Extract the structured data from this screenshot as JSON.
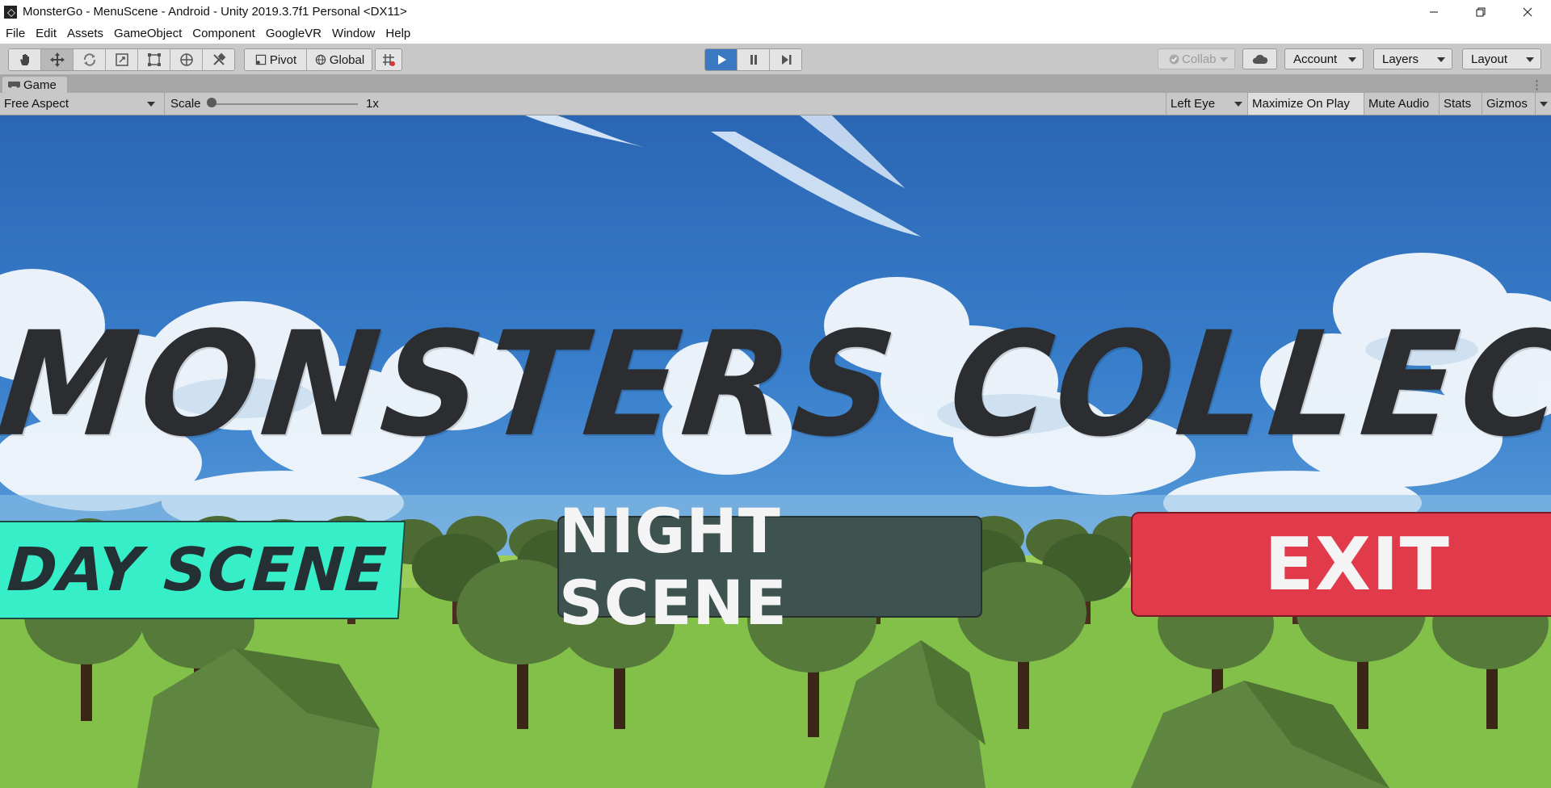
{
  "window": {
    "title": "MonsterGo - MenuScene - Android - Unity 2019.3.7f1 Personal <DX11>",
    "icon": "unity-logo-icon"
  },
  "menu": [
    "File",
    "Edit",
    "Assets",
    "GameObject",
    "Component",
    "GoogleVR",
    "Window",
    "Help"
  ],
  "toolbar": {
    "tools": [
      "hand-tool-icon",
      "move-tool-icon",
      "rotate-tool-icon",
      "scale-tool-icon",
      "rect-tool-icon",
      "transform-tool-icon",
      "custom-tool-icon"
    ],
    "pivot_label": "Pivot",
    "global_label": "Global",
    "play_state": "playing",
    "collab_label": "Collab",
    "account_label": "Account",
    "layers_label": "Layers",
    "layout_label": "Layout"
  },
  "game_panel": {
    "tab_label": "Game",
    "aspect": "Free Aspect",
    "scale_label": "Scale",
    "scale_value": "1x",
    "eye": "Left Eye",
    "maximize_label": "Maximize On Play",
    "mute_label": "Mute Audio",
    "stats_label": "Stats",
    "gizmos_label": "Gizmos"
  },
  "game": {
    "title": "MONSTERS COLLECTER",
    "buttons": {
      "day": "DAY SCENE",
      "night": "NIGHT SCENE",
      "exit": "EXIT"
    }
  },
  "colors": {
    "play_active": "#3b78c2",
    "day_button": "#36efc8",
    "night_button": "#3e5350",
    "exit_button": "#e03a4b"
  }
}
